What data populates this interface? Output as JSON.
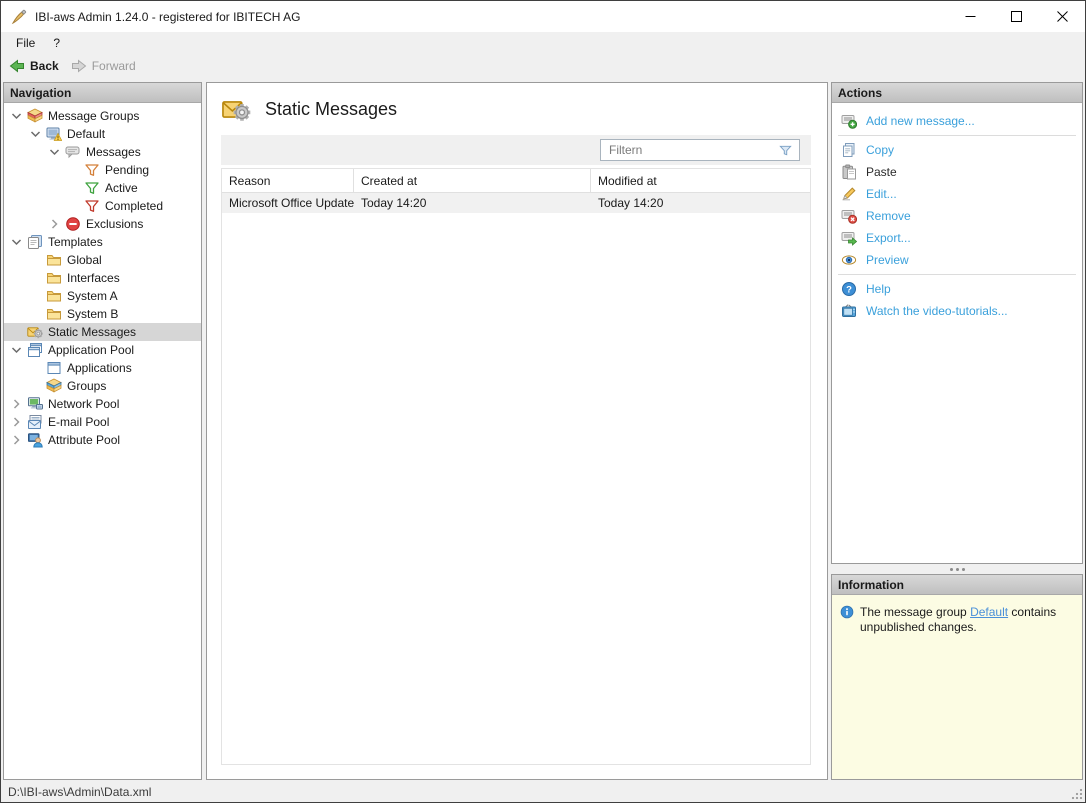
{
  "window": {
    "title": "IBI-aws Admin 1.24.0 - registered for IBITECH AG",
    "app_icon": "pen"
  },
  "menu": {
    "items": [
      {
        "label": "File"
      },
      {
        "label": "?"
      }
    ]
  },
  "toolbar": {
    "back": {
      "label": "Back",
      "icon": "back-arrow",
      "enabled": true
    },
    "forward": {
      "label": "Forward",
      "icon": "forward-arrow",
      "enabled": false
    }
  },
  "navigation": {
    "header": "Navigation",
    "tree": [
      {
        "label": "Message Groups",
        "level": 0,
        "chevron": "expanded",
        "icon": "message-groups"
      },
      {
        "label": "Default",
        "level": 1,
        "chevron": "expanded",
        "icon": "monitor-warning"
      },
      {
        "label": "Messages",
        "level": 2,
        "chevron": "expanded",
        "icon": "speech-bubbles"
      },
      {
        "label": "Pending",
        "level": 3,
        "chevron": "none",
        "icon": "funnel-orange"
      },
      {
        "label": "Active",
        "level": 3,
        "chevron": "none",
        "icon": "funnel-green"
      },
      {
        "label": "Completed",
        "level": 3,
        "chevron": "none",
        "icon": "funnel-red"
      },
      {
        "label": "Exclusions",
        "level": 2,
        "chevron": "collapsed",
        "icon": "minus-circle"
      },
      {
        "label": "Templates",
        "level": 0,
        "chevron": "expanded",
        "icon": "templates"
      },
      {
        "label": "Global",
        "level": 1,
        "chevron": "none",
        "icon": "folder"
      },
      {
        "label": "Interfaces",
        "level": 1,
        "chevron": "none",
        "icon": "folder"
      },
      {
        "label": "System A",
        "level": 1,
        "chevron": "none",
        "icon": "folder"
      },
      {
        "label": "System B",
        "level": 1,
        "chevron": "none",
        "icon": "folder"
      },
      {
        "label": "Static Messages",
        "level": 0,
        "chevron": "none",
        "icon": "static-messages",
        "selected": true
      },
      {
        "label": "Application Pool",
        "level": 0,
        "chevron": "expanded",
        "icon": "app-pool"
      },
      {
        "label": "Applications",
        "level": 1,
        "chevron": "none",
        "icon": "app-window"
      },
      {
        "label": "Groups",
        "level": 1,
        "chevron": "none",
        "icon": "groups"
      },
      {
        "label": "Network Pool",
        "level": 0,
        "chevron": "collapsed",
        "icon": "network"
      },
      {
        "label": "E-mail Pool",
        "level": 0,
        "chevron": "collapsed",
        "icon": "email"
      },
      {
        "label": "Attribute Pool",
        "level": 0,
        "chevron": "collapsed",
        "icon": "attribute"
      }
    ]
  },
  "content": {
    "title": "Static Messages",
    "title_icon": "static-messages",
    "filter": {
      "placeholder": "Filtern",
      "icon": "filter-funnel"
    },
    "table": {
      "columns": [
        "Reason",
        "Created at",
        "Modified at"
      ],
      "rows": [
        [
          "Microsoft Office Update",
          "Today 14:20",
          "Today 14:20"
        ]
      ]
    }
  },
  "actions": {
    "header": "Actions",
    "items": [
      {
        "label": "Add new message...",
        "icon": "add-message",
        "enabled": true,
        "separator_after": true
      },
      {
        "label": "Copy",
        "icon": "copy",
        "enabled": true
      },
      {
        "label": "Paste",
        "icon": "paste",
        "enabled": false
      },
      {
        "label": "Edit...",
        "icon": "edit",
        "enabled": true
      },
      {
        "label": "Remove",
        "icon": "remove",
        "enabled": true
      },
      {
        "label": "Export...",
        "icon": "export",
        "enabled": true
      },
      {
        "label": "Preview",
        "icon": "preview",
        "enabled": true,
        "separator_after": true
      },
      {
        "label": "Help",
        "icon": "help",
        "enabled": true
      },
      {
        "label": "Watch the video-tutorials...",
        "icon": "video",
        "enabled": true
      }
    ]
  },
  "information": {
    "header": "Information",
    "icon": "info",
    "message_prefix": "The message group ",
    "link_text": "Default",
    "message_suffix": " contains unpublished changes."
  },
  "statusbar": {
    "path": "D:\\IBI-aws\\Admin\\Data.xml"
  },
  "colors": {
    "action_link": "#3aa0db",
    "info_link": "#4a90d9",
    "info_background": "#fcfce3",
    "selection_background": "#d6d6d6"
  }
}
